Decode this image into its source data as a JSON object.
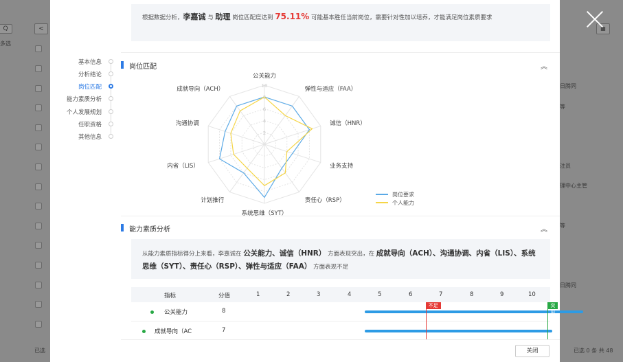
{
  "background": {
    "left_texts": [
      "多选",
      "已选"
    ],
    "right_texts": [
      "日腾同",
      "等",
      "注员",
      "理中心主管",
      "等",
      "日腾同",
      "已选 0 条  共 48"
    ],
    "btn_prev": "<",
    "btn_search": "Q"
  },
  "sidenav": {
    "items": [
      {
        "label": "基本信息",
        "active": false
      },
      {
        "label": "分析结论",
        "active": false
      },
      {
        "label": "岗位匹配",
        "active": true
      },
      {
        "label": "能力素质分析",
        "active": false
      },
      {
        "label": "个人发展规划",
        "active": false
      },
      {
        "label": "任职资格",
        "active": false
      },
      {
        "label": "其他信息",
        "active": false
      }
    ]
  },
  "summary_top": {
    "prefix": "根据数据分析，",
    "name": "李嘉诚",
    "and": " 与 ",
    "position": "助理",
    "mid": " 岗位匹配度达到 ",
    "percent": "75.11%",
    "suffix": " 可能基本胜任当前岗位，需要针对性加以培养，才能满足岗位素质要求"
  },
  "section_match": {
    "title": "岗位匹配"
  },
  "section_ability": {
    "title": "能力素质分析"
  },
  "chart_data": {
    "type": "radar",
    "axes": [
      "公关能力",
      "弹性与适应（FAA）",
      "诚信（HNR）",
      "业务支持",
      "责任心（RSP）",
      "系统思维（SYT）",
      "计划推行",
      "内省（LIS）",
      "沟通协调",
      "成就导向（ACH）"
    ],
    "range": [
      0,
      10
    ],
    "tick_labels": [
      "2",
      "4",
      "6",
      "8",
      "10"
    ],
    "series": [
      {
        "name": "岗位要求",
        "color": "#5aa9e6",
        "values": [
          8,
          8,
          8,
          5,
          5,
          9,
          6,
          8,
          7,
          8
        ]
      },
      {
        "name": "个人能力",
        "color": "#f5d547",
        "values": [
          8,
          6,
          8.5,
          4,
          6,
          7,
          5,
          5.5,
          6,
          7
        ]
      }
    ]
  },
  "summary_mid": {
    "prefix": "从能力素质指标得分上来看，李嘉诚在 ",
    "strengths": "公关能力、诚信（HNR）",
    "mid": " 方面表现突出，在 ",
    "weak": "成就导向（ACH）、沟通协调、内省（LIS）、系统思维（SYT）、责任心（RSP）、弹性与适应（FAA）",
    "suffix": " 方面表现不足"
  },
  "table": {
    "headers": [
      "指标",
      "分值",
      "1",
      "2",
      "3",
      "4",
      "5",
      "6",
      "7",
      "8",
      "9",
      "10"
    ],
    "flag_low": "不足",
    "flag_high": "突出",
    "low_threshold": 3,
    "high_threshold": 7,
    "rows": [
      {
        "name": "公关能力",
        "score": "8",
        "value": 8
      },
      {
        "name": "成就导向（AC",
        "score": "7",
        "value": 7
      }
    ]
  },
  "footer": {
    "close_label": "关闭"
  }
}
